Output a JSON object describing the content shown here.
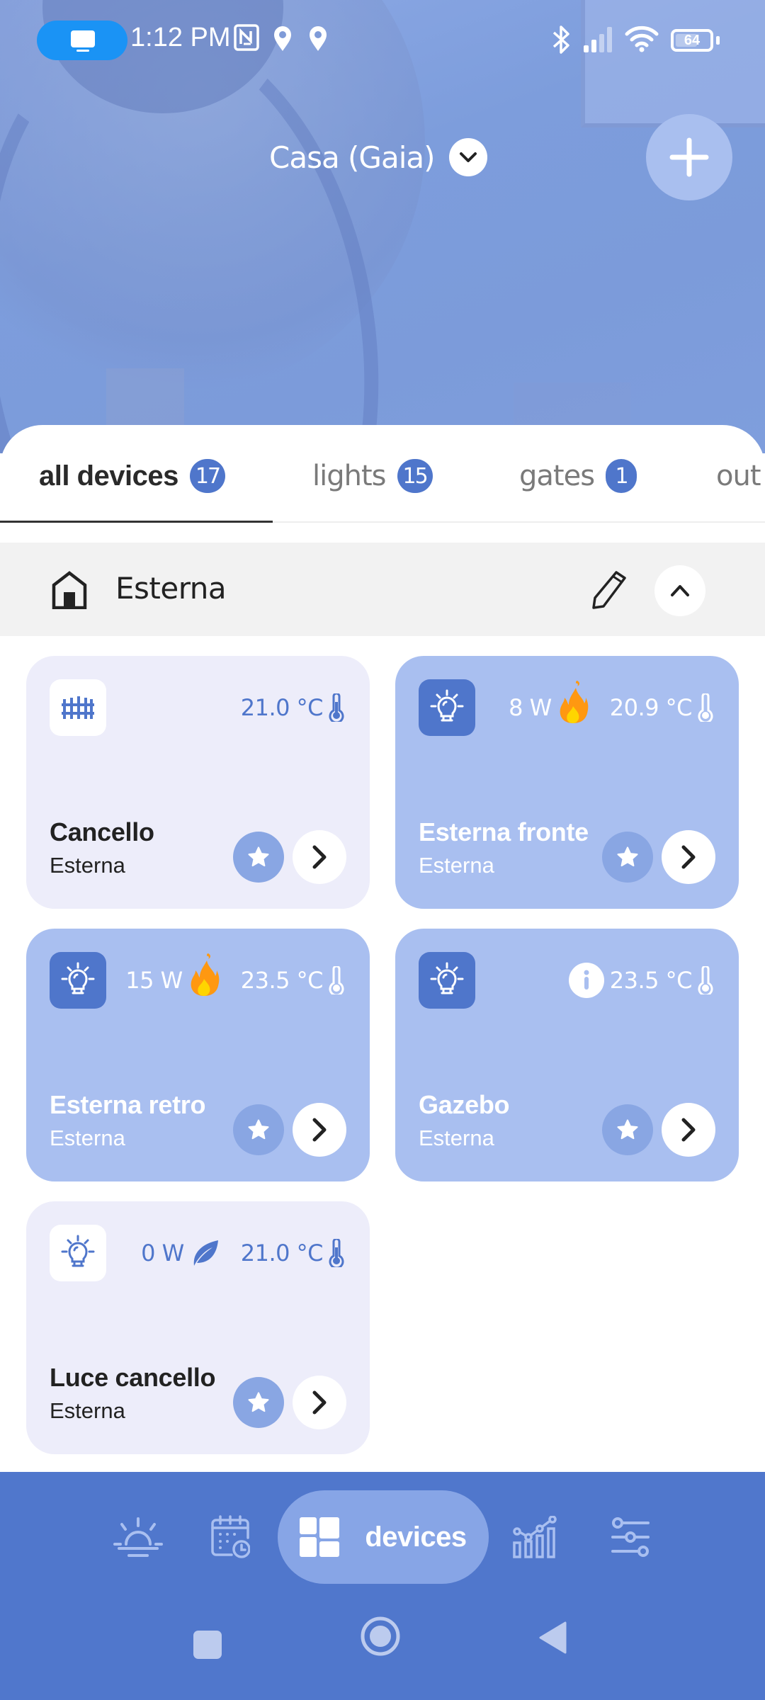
{
  "status_bar": {
    "time": "1:12 PM",
    "battery_percent": "64",
    "icons": [
      "screen-cast-icon",
      "nfc-icon",
      "location-icon",
      "location-icon",
      "bluetooth-icon",
      "signal-icon",
      "wifi-icon",
      "battery-icon"
    ]
  },
  "header": {
    "house_name": "Casa (Gaia)",
    "add_button": "add"
  },
  "tabs": [
    {
      "label": "all devices",
      "count": "17",
      "active": true
    },
    {
      "label": "lights",
      "count": "15",
      "active": false
    },
    {
      "label": "gates",
      "count": "1",
      "active": false
    },
    {
      "label": "out",
      "count": "",
      "active": false
    }
  ],
  "room": {
    "name": "Esterna"
  },
  "devices": [
    {
      "name": "Cancello",
      "room": "Esterna",
      "type": "gate",
      "state": "off",
      "power": "",
      "power_status": "",
      "temperature": "21.0 °C"
    },
    {
      "name": "Esterna fronte",
      "room": "Esterna",
      "type": "light",
      "state": "on",
      "power": "8 W",
      "power_status": "fire",
      "temperature": "20.9 °C"
    },
    {
      "name": "Esterna retro",
      "room": "Esterna",
      "type": "light",
      "state": "on",
      "power": "15 W",
      "power_status": "fire",
      "temperature": "23.5 °C"
    },
    {
      "name": "Gazebo",
      "room": "Esterna",
      "type": "light",
      "state": "on",
      "power": "",
      "power_status": "info",
      "temperature": "23.5 °C"
    },
    {
      "name": "Luce cancello",
      "room": "Esterna",
      "type": "light",
      "state": "off",
      "power": "0 W",
      "power_status": "leaf",
      "temperature": "21.0 °C"
    }
  ],
  "bottom_nav": {
    "items": [
      {
        "id": "scenes",
        "label": ""
      },
      {
        "id": "schedules",
        "label": ""
      },
      {
        "id": "devices",
        "label": "devices",
        "active": true
      },
      {
        "id": "statistics",
        "label": ""
      },
      {
        "id": "settings",
        "label": ""
      }
    ]
  },
  "colors": {
    "accent": "#4f76cb",
    "card_on": "#a9bff0",
    "card_off": "#ededfa",
    "nav_bg": "#5077cc",
    "nav_active": "#87a5e6"
  }
}
